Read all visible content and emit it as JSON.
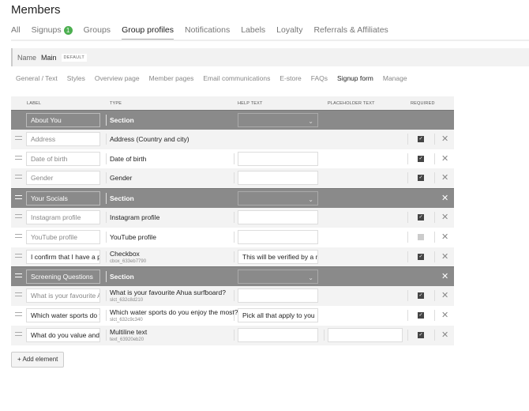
{
  "title": "Members",
  "tabs": [
    {
      "label": "All"
    },
    {
      "label": "Signups",
      "badge": "1"
    },
    {
      "label": "Groups"
    },
    {
      "label": "Group profiles"
    },
    {
      "label": "Notifications"
    },
    {
      "label": "Labels"
    },
    {
      "label": "Loyalty"
    },
    {
      "label": "Referrals & Affiliates"
    }
  ],
  "profile": {
    "name_label": "Name",
    "name": "Main",
    "badge": "DEFAULT"
  },
  "subtabs": [
    "General / Text",
    "Styles",
    "Overview page",
    "Member pages",
    "Email communications",
    "E-store",
    "FAQs",
    "Signup form",
    "Manage"
  ],
  "columns": {
    "label": "LABEL",
    "type": "TYPE",
    "help": "HELP TEXT",
    "placeholder": "PLACEHOLDER TEXT",
    "required": "REQUIRED"
  },
  "rows": [
    {
      "label": "About You",
      "type": "Section"
    },
    {
      "label": "Address",
      "type": "Address (Country and city)"
    },
    {
      "label": "Date of birth",
      "type": "Date of birth",
      "help": ""
    },
    {
      "label": "Gender",
      "type": "Gender",
      "help": ""
    },
    {
      "label": "Your Socials",
      "type": "Section"
    },
    {
      "label": "Instagram profile",
      "type": "Instagram profile",
      "help": ""
    },
    {
      "label": "YouTube profile",
      "type": "YouTube profile",
      "help": ""
    },
    {
      "label": "I confirm that I have a pu",
      "type": "Checkbox",
      "id": "cbox_633eb7790",
      "help": "This will be verified by a m"
    },
    {
      "label": "Screening Questions",
      "type": "Section"
    },
    {
      "label": "What is your favourite A",
      "type": "What is your favourite Ahua surfboard?",
      "id": "slct_632c8d210",
      "help": ""
    },
    {
      "label": "Which water sports do y",
      "type": "Which water sports do you enjoy the most?",
      "id": "slct_632c9c340",
      "help": "Pick all that apply to you"
    },
    {
      "label": "What do you value and l",
      "type": "Multiline text",
      "id": "text_63920eb20",
      "help": "",
      "placeholder": ""
    }
  ],
  "add_label": "+ Add element"
}
